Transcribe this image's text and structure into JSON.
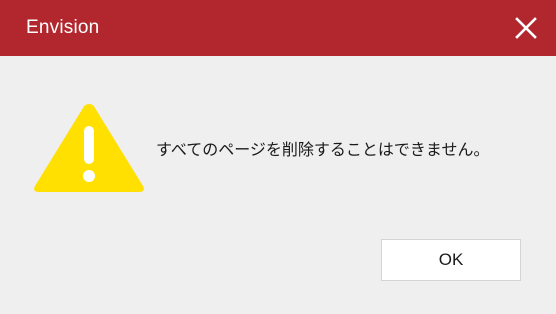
{
  "window": {
    "title": "Envision",
    "close_icon": "close-icon"
  },
  "dialog": {
    "icon": "warning-icon",
    "message": "すべてのページを削除することはできません。",
    "ok_label": "OK"
  },
  "colors": {
    "titlebar": "#b2272e",
    "background": "#efefef",
    "warning_fill": "#ffe000"
  }
}
